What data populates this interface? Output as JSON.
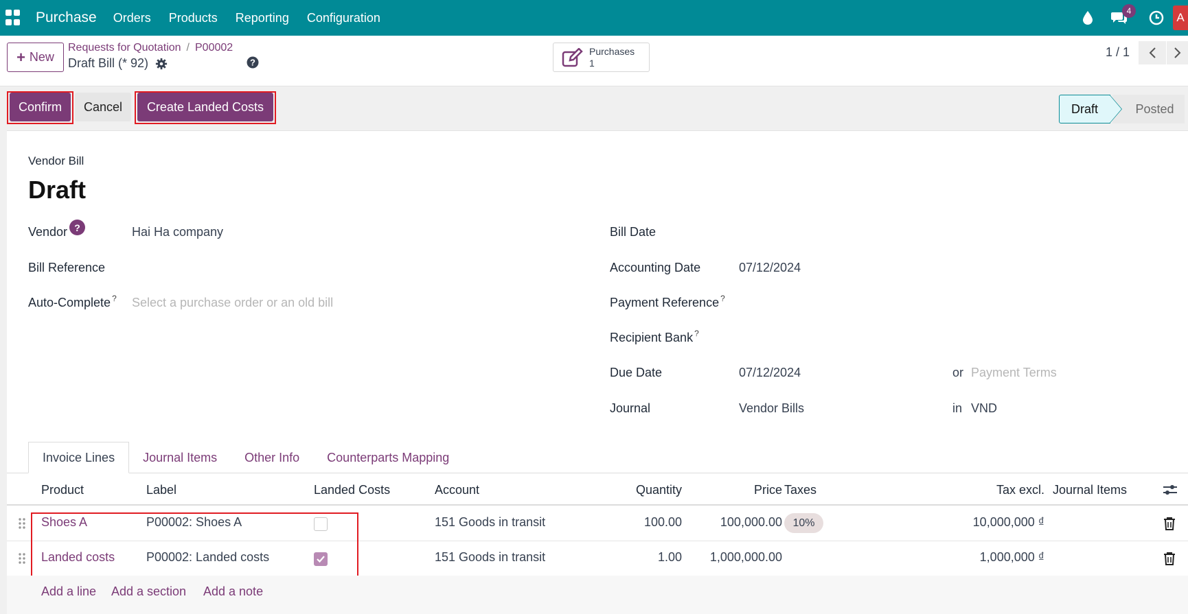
{
  "navbar": {
    "brand": "Purchase",
    "menu": [
      "Orders",
      "Products",
      "Reporting",
      "Configuration"
    ],
    "chat_badge": "4",
    "avatar_letter": "A",
    "color": "#018a96"
  },
  "control": {
    "new_label": "New",
    "breadcrumb": [
      "Requests for Quotation",
      "P00002"
    ],
    "record_title": "Draft Bill (* 92)",
    "smart_button": {
      "label": "Purchases",
      "count": "1"
    },
    "pager": "1 / 1"
  },
  "statusbar": {
    "confirm": "Confirm",
    "cancel": "Cancel",
    "create_landed_costs": "Create Landed Costs",
    "stages": [
      "Draft",
      "Posted"
    ],
    "active_stage": "Draft"
  },
  "form": {
    "type": "Vendor Bill",
    "name": "Draft",
    "left": {
      "vendor_label": "Vendor",
      "vendor_value": "Hai Ha company",
      "bill_ref_label": "Bill Reference",
      "autocomplete_label": "Auto-Complete",
      "autocomplete_placeholder": "Select a purchase order or an old bill"
    },
    "right": {
      "bill_date_label": "Bill Date",
      "accounting_date_label": "Accounting Date",
      "accounting_date_value": "07/12/2024",
      "payment_ref_label": "Payment Reference",
      "recipient_bank_label": "Recipient Bank",
      "due_date_label": "Due Date",
      "due_date_value": "07/12/2024",
      "or": "or",
      "payment_terms_placeholder": "Payment Terms",
      "journal_label": "Journal",
      "journal_value": "Vendor Bills",
      "in": "in",
      "currency": "VND"
    },
    "superscript": "?"
  },
  "tabs": [
    "Invoice Lines",
    "Journal Items",
    "Other Info",
    "Counterparts Mapping"
  ],
  "table": {
    "headers": [
      "Product",
      "Label",
      "Landed Costs",
      "Account",
      "Quantity",
      "Price",
      "Taxes",
      "Tax excl.",
      "Journal Items"
    ],
    "rows": [
      {
        "product": "Shoes A",
        "label": "P00002: Shoes A",
        "landed": false,
        "account": "151 Goods in transit",
        "quantity": "100.00",
        "price": "100,000.00",
        "taxes": "10%",
        "tax_excl": "10,000,000 ₫"
      },
      {
        "product": "Landed costs",
        "label": "P00002: Landed costs",
        "landed": true,
        "account": "151 Goods in transit",
        "quantity": "1.00",
        "price": "1,000,000.00",
        "taxes": "",
        "tax_excl": "1,000,000 ₫"
      }
    ],
    "add_links": [
      "Add a line",
      "Add a section",
      "Add a note"
    ]
  }
}
